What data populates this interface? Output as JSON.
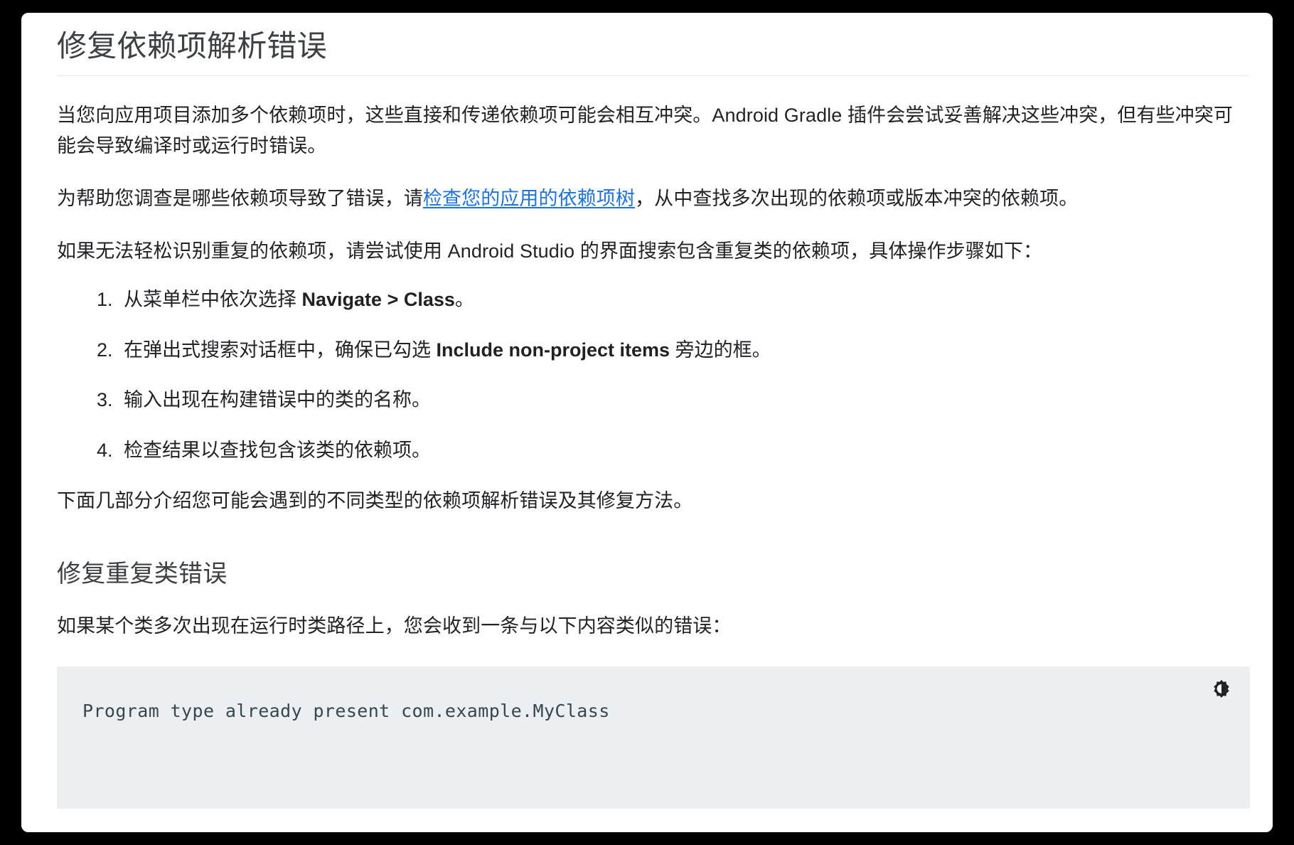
{
  "page": {
    "title": "修复依赖项解析错误"
  },
  "content": {
    "paragraph_1": "当您向应用项目添加多个依赖项时，这些直接和传递依赖项可能会相互冲突。Android Gradle 插件会尝试妥善解决这些冲突，但有些冲突可能会导致编译时或运行时错误。",
    "paragraph_2_before_link": "为帮助您调查是哪些依赖项导致了错误，请",
    "paragraph_2_link": "检查您的应用的依赖项树",
    "paragraph_2_after_link": "，从中查找多次出现的依赖项或版本冲突的依赖项。",
    "paragraph_3": "如果无法轻松识别重复的依赖项，请尝试使用 Android Studio 的界面搜索包含重复类的依赖项，具体操作步骤如下：",
    "steps": [
      {
        "prefix": "从菜单栏中依次选择 ",
        "bold": "Navigate > Class",
        "suffix": "。"
      },
      {
        "prefix": "在弹出式搜索对话框中，确保已勾选 ",
        "bold": "Include non-project items",
        "suffix": " 旁边的框。"
      },
      {
        "prefix": "输入出现在构建错误中的类的名称。",
        "bold": "",
        "suffix": ""
      },
      {
        "prefix": "检查结果以查找包含该类的依赖项。",
        "bold": "",
        "suffix": ""
      }
    ],
    "paragraph_4": "下面几部分介绍您可能会遇到的不同类型的依赖项解析错误及其修复方法。",
    "section_heading": "修复重复类错误",
    "paragraph_5": "如果某个类多次出现在运行时类路径上，您会收到一条与以下内容类似的错误：",
    "code_sample": "Program type already present com.example.MyClass",
    "code_toolbar": {
      "dark_mode_icon": "brightness-toggle-icon"
    }
  },
  "colors": {
    "link": "#1a73e8",
    "text": "#212326",
    "title": "#3c4043",
    "code_background": "#eceff1",
    "page_background": "#ffffff",
    "outer_background": "#000000"
  }
}
